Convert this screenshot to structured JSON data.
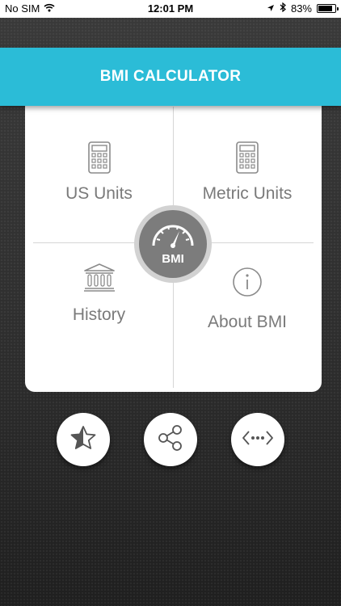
{
  "status_bar": {
    "carrier": "No SIM",
    "time": "12:01 PM",
    "battery_percent": "83%",
    "battery_level": 0.83
  },
  "header": {
    "title": "BMI CALCULATOR"
  },
  "menu": {
    "us_units": {
      "label": "US Units",
      "icon": "calculator-icon"
    },
    "metric_units": {
      "label": "Metric Units",
      "icon": "calculator-icon"
    },
    "history": {
      "label": "History",
      "icon": "museum-icon"
    },
    "about": {
      "label": "About BMI",
      "icon": "info-icon"
    }
  },
  "center_badge": {
    "label": "BMI",
    "icon": "gauge-icon"
  },
  "actions": {
    "favorite": {
      "icon": "star-icon"
    },
    "share": {
      "icon": "share-icon"
    },
    "more": {
      "icon": "more-apps-icon"
    }
  },
  "colors": {
    "accent": "#2bbcd7",
    "card": "#ffffff",
    "label": "#7a7a7a",
    "badge": "#7c7c7c"
  }
}
